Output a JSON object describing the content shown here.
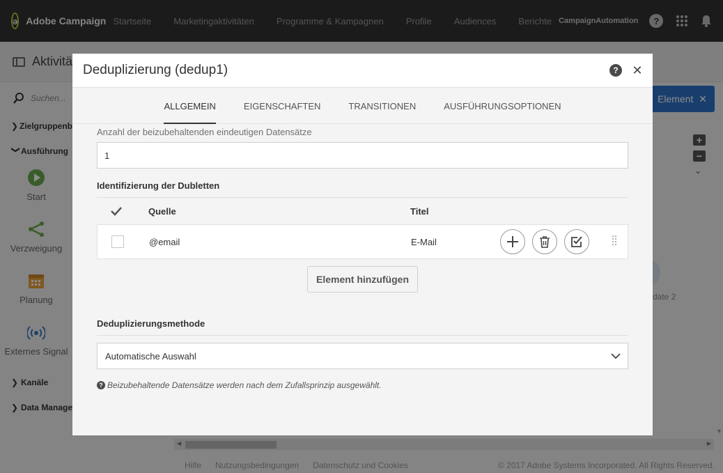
{
  "app": {
    "brand": "Adobe Campaign",
    "nav": [
      "Startseite",
      "Marketingaktivitäten",
      "Programme & Kampagnen",
      "Profile",
      "Audiences",
      "Berichte"
    ],
    "org": "CampaignAutomation"
  },
  "background": {
    "page_title": "Aktivitä",
    "search_placeholder": "Suchen...",
    "sections": [
      "Zielgruppenb",
      "Ausführung",
      "Kanäle",
      "Data Manage"
    ],
    "activities": [
      "Start",
      "Verzweigung",
      "Planung",
      "Externes Signal"
    ],
    "element_button": "Element",
    "node_label": "date 2",
    "footer": {
      "links": [
        "Hilfe",
        "Nutzungsbedingungen",
        "Datenschutz und Cookies"
      ],
      "copyright": "© 2017 Adobe Systems Incorporated. All Rights Reserved."
    }
  },
  "dialog": {
    "title": "Deduplizierung (dedup1)",
    "tabs": [
      "ALLGEMEIN",
      "EIGENSCHAFTEN",
      "TRANSITIONEN",
      "AUSFÜHRUNGSOPTIONEN"
    ],
    "active_tab": "ALLGEMEIN",
    "records_label": "Anzahl der beizubehaltenden eindeutigen Datensätze",
    "records_value": "1",
    "dup_section_title": "Identifizierung der Dubletten",
    "table": {
      "headers": [
        "Quelle",
        "Titel"
      ],
      "rows": [
        {
          "source": "@email",
          "title": "E-Mail"
        }
      ]
    },
    "add_button": "Element hinzufügen",
    "method_title": "Deduplizierungsmethode",
    "method_value": "Automatische Auswahl",
    "hint": "Beizubehaltende Datensätze werden nach dem Zufallsprinzip ausgewählt."
  },
  "colors": {
    "topbar": "#323232",
    "primary": "#2d72c8",
    "activity_green": "#6aa84f",
    "planning_orange": "#e8a33d",
    "signal_blue": "#3b79c4"
  }
}
